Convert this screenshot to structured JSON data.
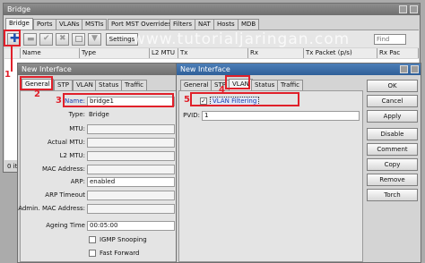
{
  "watermark": "www.tutorialjaringan.com",
  "bridge_window": {
    "title": "Bridge",
    "tabs": [
      "Bridge",
      "Ports",
      "VLANs",
      "MSTIs",
      "Port MST Overrides",
      "Filters",
      "NAT",
      "Hosts",
      "MDB"
    ],
    "settings_label": "Settings",
    "find_placeholder": "Find",
    "columns": [
      "Name",
      "Type",
      "L2 MTU",
      "Tx",
      "Rx",
      "Tx Packet (p/s)",
      "Rx Pac"
    ],
    "status_text": "0 ite"
  },
  "general_window": {
    "title": "New Interface",
    "tabs": [
      "General",
      "STP",
      "VLAN",
      "Status",
      "Traffic"
    ],
    "fields": {
      "name_label": "Name:",
      "name_value": "bridge1",
      "type_label": "Type:",
      "type_value": "Bridge",
      "mtu_label": "MTU:",
      "actual_mtu_label": "Actual MTU:",
      "l2mtu_label": "L2 MTU:",
      "mac_label": "MAC Address:",
      "arp_label": "ARP:",
      "arp_value": "enabled",
      "arp_timeout_label": "ARP Timeout",
      "admin_mac_label": "Admin. MAC Address:",
      "ageing_label": "Ageing Time",
      "ageing_value": "00:05:00",
      "igmp_label": "IGMP Snooping",
      "fast_forward_label": "Fast Forward"
    }
  },
  "vlan_window": {
    "title": "New Interface",
    "tabs": [
      "General",
      "STP",
      "VLAN",
      "Status",
      "Traffic"
    ],
    "vlan_filtering_label": "VLAN Filtering",
    "pvid_label": "PVID:",
    "pvid_value": "1",
    "buttons": [
      "OK",
      "Cancel",
      "Apply",
      "Disable",
      "Comment",
      "Copy",
      "Remove",
      "Torch"
    ]
  },
  "annotations": [
    "1",
    "2",
    "3",
    "4",
    "5"
  ]
}
